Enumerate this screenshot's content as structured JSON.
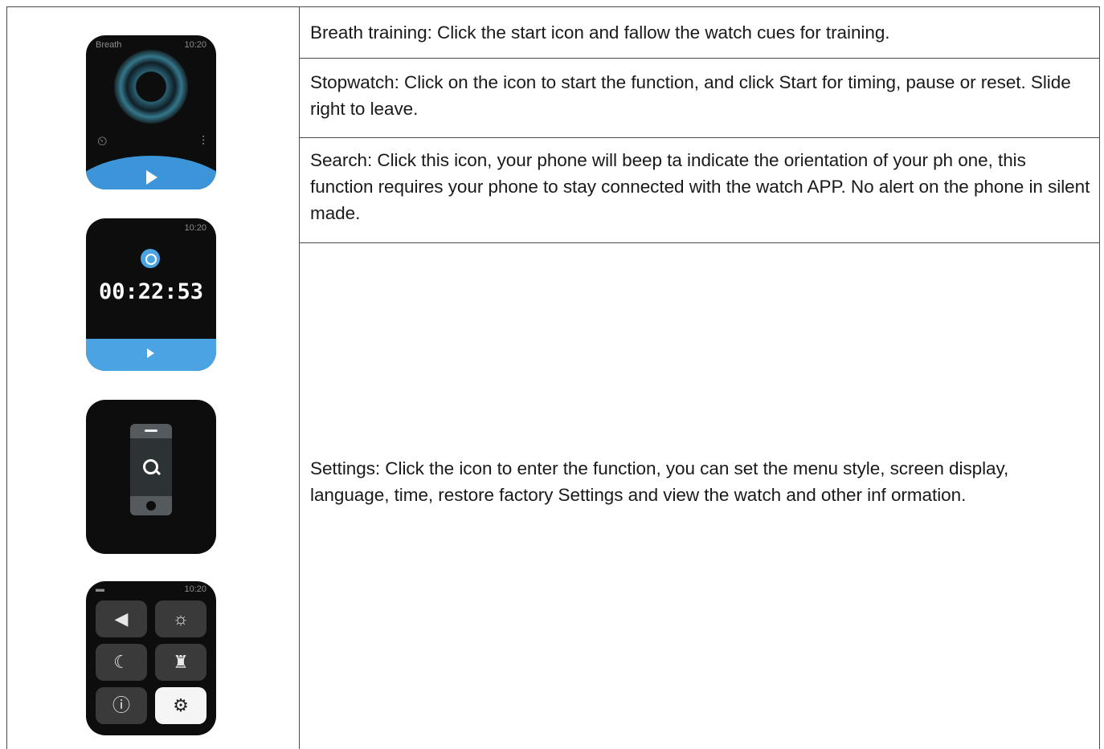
{
  "rows": [
    {
      "text": "Breath training: Click the start icon and fallow the watch cues for training."
    },
    {
      "text": "Stopwatch: Click on the icon to start the function, and click Start for timing, pause or reset. Slide right to leave."
    },
    {
      "text": "Search: Click this icon, your phone will beep ta indicate the orientation of your ph one, this function requires your phone to stay connected with the watch APP. No alert on the phone in silent made."
    },
    {
      "text": "Settings: Click the icon to enter the function, you can set the menu style, screen display, language, time, restore factory Settings and view the watch and other inf ormation."
    }
  ],
  "watches": {
    "breath": {
      "label": "Breath",
      "time": "10:20"
    },
    "stopwatch": {
      "time": "10:20",
      "display": "00:22:53"
    },
    "settings": {
      "time": "10:20"
    }
  }
}
